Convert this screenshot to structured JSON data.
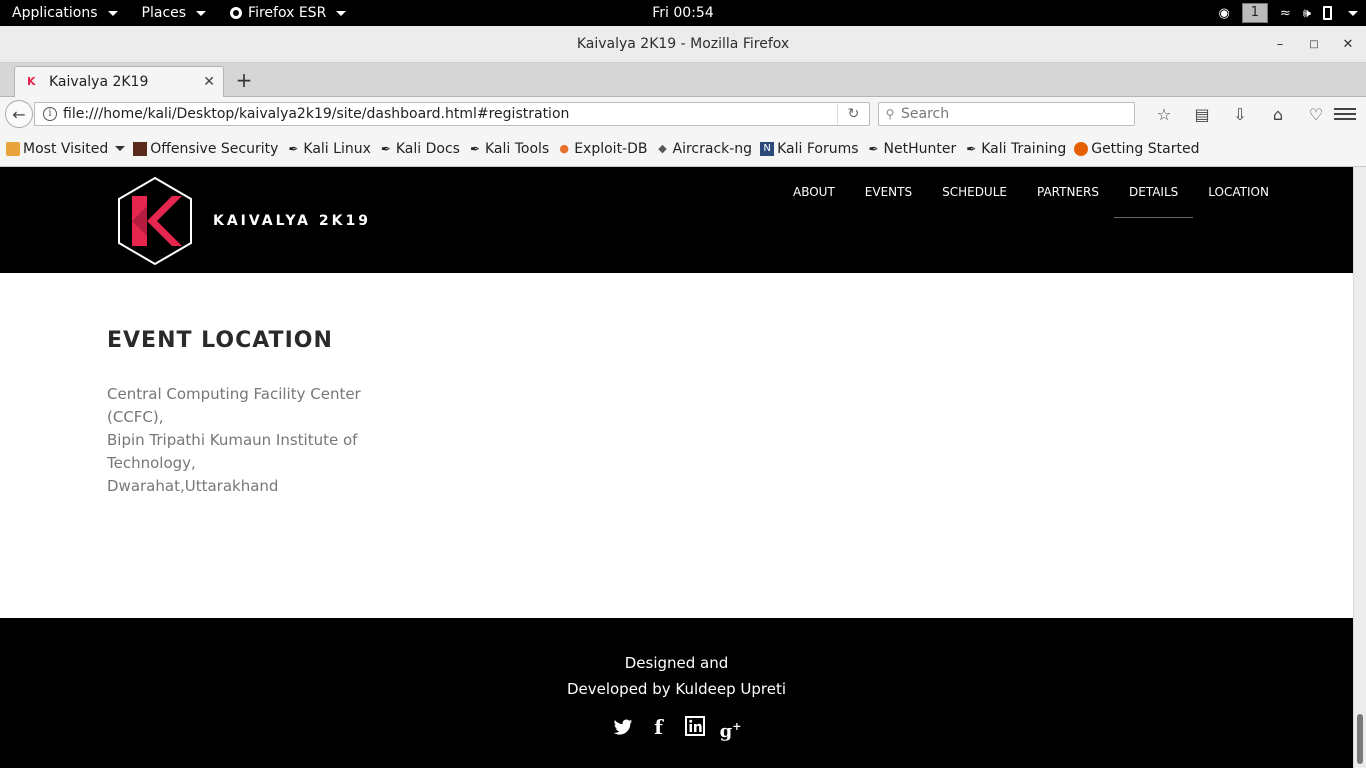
{
  "gnome_bar": {
    "applications": "Applications",
    "places": "Places",
    "browser_app": "Firefox ESR",
    "clock": "Fri 00:54",
    "workspace": "1"
  },
  "window": {
    "title": "Kaivalya 2K19 - Mozilla Firefox"
  },
  "tabs": [
    {
      "title": "Kaivalya 2K19"
    }
  ],
  "navbar": {
    "url": "file:///home/kali/Desktop/kaivalya2k19/site/dashboard.html#registration",
    "search_placeholder": "Search"
  },
  "bookmarks": [
    {
      "label": "Most Visited",
      "icon": "folder-icon"
    },
    {
      "label": "Offensive Security",
      "icon": "offsec-icon"
    },
    {
      "label": "Kali Linux",
      "icon": "kali-dragon-icon"
    },
    {
      "label": "Kali Docs",
      "icon": "kali-dragon-icon"
    },
    {
      "label": "Kali Tools",
      "icon": "kali-dragon-icon"
    },
    {
      "label": "Exploit-DB",
      "icon": "exploitdb-icon"
    },
    {
      "label": "Aircrack-ng",
      "icon": "aircrack-icon"
    },
    {
      "label": "Kali Forums",
      "icon": "kali-forums-icon"
    },
    {
      "label": "NetHunter",
      "icon": "kali-dragon-icon"
    },
    {
      "label": "Kali Training",
      "icon": "kali-dragon-icon"
    },
    {
      "label": "Getting Started",
      "icon": "firefox-icon"
    }
  ],
  "site": {
    "brand": "KAIVALYA 2K19",
    "nav": [
      "ABOUT",
      "EVENTS",
      "SCHEDULE",
      "PARTNERS",
      "DETAILS",
      "LOCATION"
    ],
    "active_nav": "DETAILS",
    "location": {
      "title": "EVENT LOCATION",
      "lines": [
        "Central Computing Facility Center (CCFC),",
        "Bipin Tripathi Kumaun Institute of Technology,",
        "Dwarahat,Uttarakhand"
      ]
    },
    "footer": {
      "line1": "Designed and",
      "line2": "Developed by Kuldeep Upreti",
      "social": [
        "twitter-icon",
        "facebook-icon",
        "linkedin-icon",
        "google-plus-icon"
      ]
    }
  },
  "colors": {
    "logo_accent": "#e5264f",
    "logo_accent_dark": "#b51d40"
  }
}
